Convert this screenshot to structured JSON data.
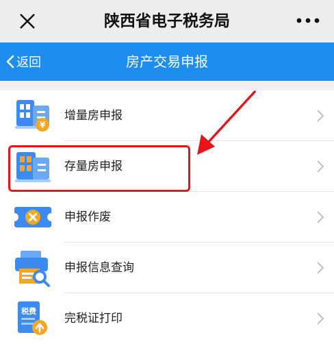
{
  "wechat_bar": {
    "title": "陕西省电子税务局",
    "close_icon": "close-icon",
    "more_icon": "more-icon"
  },
  "app_bar": {
    "back_label": "返回",
    "title": "房产交易申报"
  },
  "menu": {
    "items": [
      {
        "label": "增量房申报",
        "icon": "incremental-house-icon"
      },
      {
        "label": "存量房申报",
        "icon": "existing-house-icon"
      },
      {
        "label": "申报作废",
        "icon": "cancel-declaration-icon"
      },
      {
        "label": "申报信息查询",
        "icon": "query-info-icon"
      },
      {
        "label": "完税证打印",
        "icon": "tax-certificate-print-icon"
      }
    ],
    "icon_text": {
      "yen": "¥",
      "tax_fee": "税费"
    }
  },
  "annotation": {
    "highlight_color": "#e8141a"
  },
  "colors": {
    "app_bar": "#1d8ef0",
    "icon_blue": "#3d8af0",
    "icon_orange": "#f5a623"
  }
}
